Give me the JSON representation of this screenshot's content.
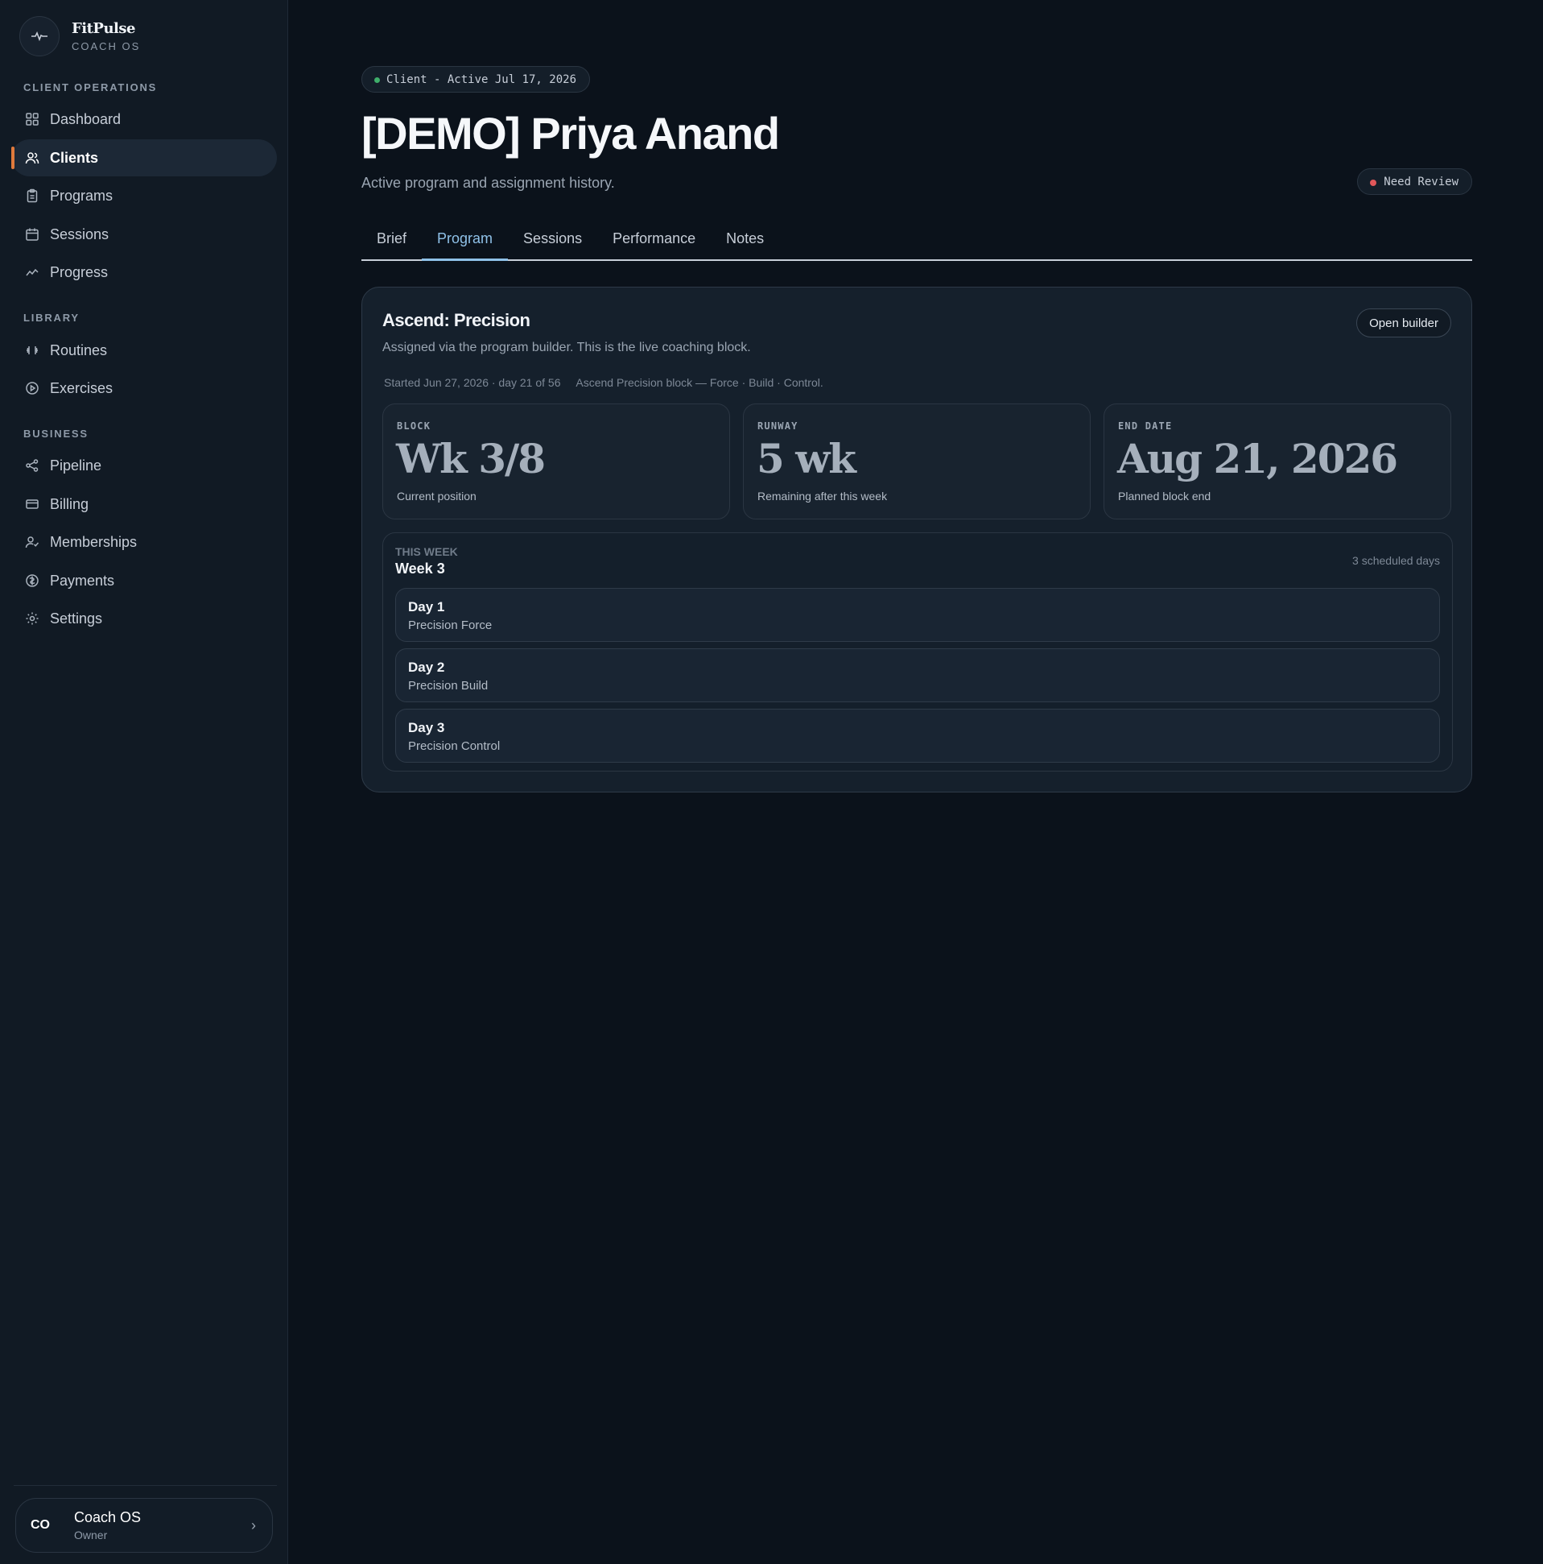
{
  "brand": {
    "name": "FitPulse",
    "subtitle": "COACH OS"
  },
  "sidebar": {
    "sections": [
      {
        "label": "CLIENT OPERATIONS"
      },
      {
        "label": "LIBRARY"
      },
      {
        "label": "BUSINESS"
      }
    ],
    "items": [
      {
        "label": "Dashboard",
        "icon": "grid-icon"
      },
      {
        "label": "Clients",
        "icon": "users-icon",
        "active": true
      },
      {
        "label": "Programs",
        "icon": "clipboard-icon"
      },
      {
        "label": "Sessions",
        "icon": "calendar-icon"
      },
      {
        "label": "Progress",
        "icon": "trend-icon"
      },
      {
        "label": "Routines",
        "icon": "dumbbell-icon"
      },
      {
        "label": "Exercises",
        "icon": "play-circle-icon"
      },
      {
        "label": "Pipeline",
        "icon": "share-nodes-icon"
      },
      {
        "label": "Billing",
        "icon": "credit-card-icon"
      },
      {
        "label": "Memberships",
        "icon": "user-check-icon"
      },
      {
        "label": "Payments",
        "icon": "coin-icon"
      },
      {
        "label": "Settings",
        "icon": "gear-icon"
      }
    ],
    "user": {
      "initials": "CO",
      "name": "Coach OS",
      "role": "Owner"
    }
  },
  "header": {
    "status": "Client - Active Jul 17, 2026",
    "title": "[DEMO] Priya Anand",
    "subtitle": "Active program and assignment history.",
    "review_badge": "Need Review"
  },
  "tabs": [
    {
      "label": "Brief"
    },
    {
      "label": "Program",
      "active": true
    },
    {
      "label": "Sessions"
    },
    {
      "label": "Performance"
    },
    {
      "label": "Notes"
    }
  ],
  "program": {
    "title": "Ascend: Precision",
    "description": "Assigned via the program builder. This is the live coaching block.",
    "open_builder_label": "Open builder",
    "meta_started": "Started Jun 27, 2026 · day 21 of 56",
    "meta_block": "Ascend Precision block — Force · Build · Control.",
    "stats": [
      {
        "label": "BLOCK",
        "value": "Wk 3/8",
        "hint": "Current position"
      },
      {
        "label": "RUNWAY",
        "value": "5 wk",
        "hint": "Remaining after this week"
      },
      {
        "label": "END DATE",
        "value": "Aug 21, 2026",
        "hint": "Planned block end"
      }
    ],
    "week": {
      "eyebrow": "THIS WEEK",
      "title": "Week 3",
      "count": "3 scheduled days",
      "days": [
        {
          "name": "Day 1",
          "routine": "Precision Force"
        },
        {
          "name": "Day 2",
          "routine": "Precision Build"
        },
        {
          "name": "Day 3",
          "routine": "Precision Control"
        }
      ]
    }
  },
  "colors": {
    "accent": "#8fc1e8",
    "active_marker": "#e07a3c",
    "status_active": "#3fae6a",
    "status_review": "#e0575a"
  }
}
